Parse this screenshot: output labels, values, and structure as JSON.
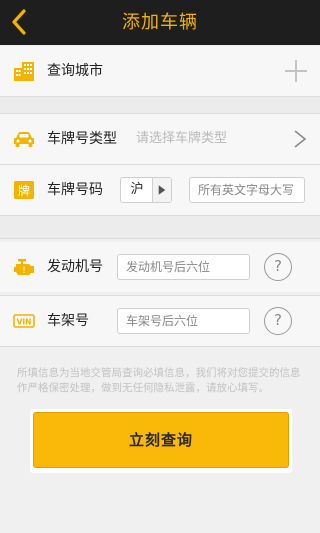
{
  "header": {
    "title": "添加车辆"
  },
  "city": {
    "label": "查询城市"
  },
  "plate_type": {
    "label": "车牌号类型",
    "placeholder": "请选择车牌类型"
  },
  "plate_number": {
    "label": "车牌号码",
    "province": "沪",
    "placeholder": "所有英文字母大写"
  },
  "engine": {
    "label": "发动机号",
    "placeholder": "发动机号后六位"
  },
  "vin": {
    "label": "车架号",
    "placeholder": "车架号后六位"
  },
  "help_glyph": "?",
  "notice": "所填信息为当地交管局查询必填信息，我们将对您提交的信息作严格保密处理，做到无任何隐私泄露，请放心填写。",
  "submit": {
    "label": "立刻查询"
  },
  "colors": {
    "accent": "#f3b400",
    "header_bg": "#1e1e1e",
    "button": "#fab908"
  }
}
